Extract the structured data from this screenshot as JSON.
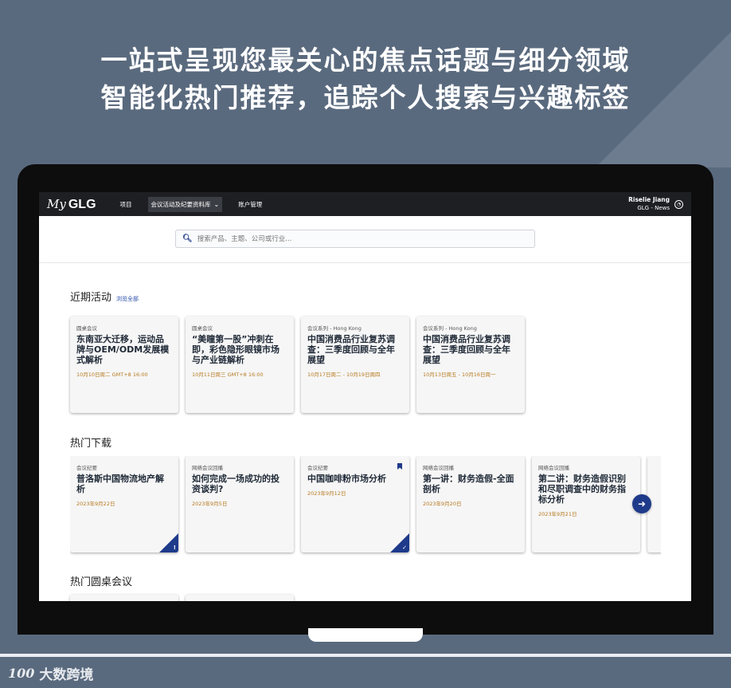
{
  "headline": {
    "line1": "一站式呈现您最关心的焦点话题与细分领域",
    "line2": "智能化热门推荐，追踪个人搜索与兴趣标签"
  },
  "brand": {
    "logo": "100",
    "name": "大数跨境"
  },
  "app": {
    "logo_my": "My",
    "logo_glg": "GLG",
    "nav": [
      {
        "label": "项目"
      },
      {
        "label": "会议活动及纪要资料库",
        "active": true
      },
      {
        "label": "账户管理"
      }
    ],
    "user": {
      "name": "Riselie Jiang",
      "org": "GLG - News"
    },
    "search": {
      "placeholder": "搜索产品、主题、公司或行业..."
    }
  },
  "sections": {
    "recent": {
      "title": "近期活动",
      "browse_all": "浏览全部",
      "cards": [
        {
          "type": "圆桌会议",
          "title": "东南亚大迁移，运动品牌与OEM/ODM发展模式解析",
          "date": "10月10日周二 GMT+8 16:00"
        },
        {
          "type": "圆桌会议",
          "title": "“美瞳第一股”冲刺在即，彩色隐形眼镜市场与产业链解析",
          "date": "10月11日周三 GMT+8 16:00"
        },
        {
          "type": "会议系列 - Hong Kong",
          "title": "中国消费品行业复苏调查：三季度回顾与全年展望",
          "date": "10月17日周二 - 10月19日周四"
        },
        {
          "type": "会议系列 - Hong Kong",
          "title": "中国消费品行业复苏调查：三季度回顾与全年展望",
          "date": "10月13日周五 - 10月16日周一"
        }
      ]
    },
    "downloads": {
      "title": "热门下载",
      "cards": [
        {
          "type": "会议纪要",
          "title": "普洛斯中国物流地产解析",
          "date": "2023年9月22日",
          "corner": "!"
        },
        {
          "type": "网络会议回播",
          "title": "如何完成一场成功的投资谈判?",
          "date": "2023年9月5日"
        },
        {
          "type": "会议纪要",
          "title": "中国咖啡粉市场分析",
          "date": "2023年9月12日",
          "corner": "✓",
          "bookmark": true
        },
        {
          "type": "网络会议回播",
          "title": "第一讲：财务造假-全面剖析",
          "date": "2023年9月20日"
        },
        {
          "type": "网络会议回播",
          "title": "第二讲：财务造假识别和尽职调查中的财务指标分析",
          "date": "2023年9月21日"
        }
      ]
    },
    "roundtables": {
      "title": "热门圆桌会议"
    }
  },
  "colors": {
    "accent": "#1e3a8a",
    "date": "#b7791f",
    "topbar": "#1d1f23"
  }
}
